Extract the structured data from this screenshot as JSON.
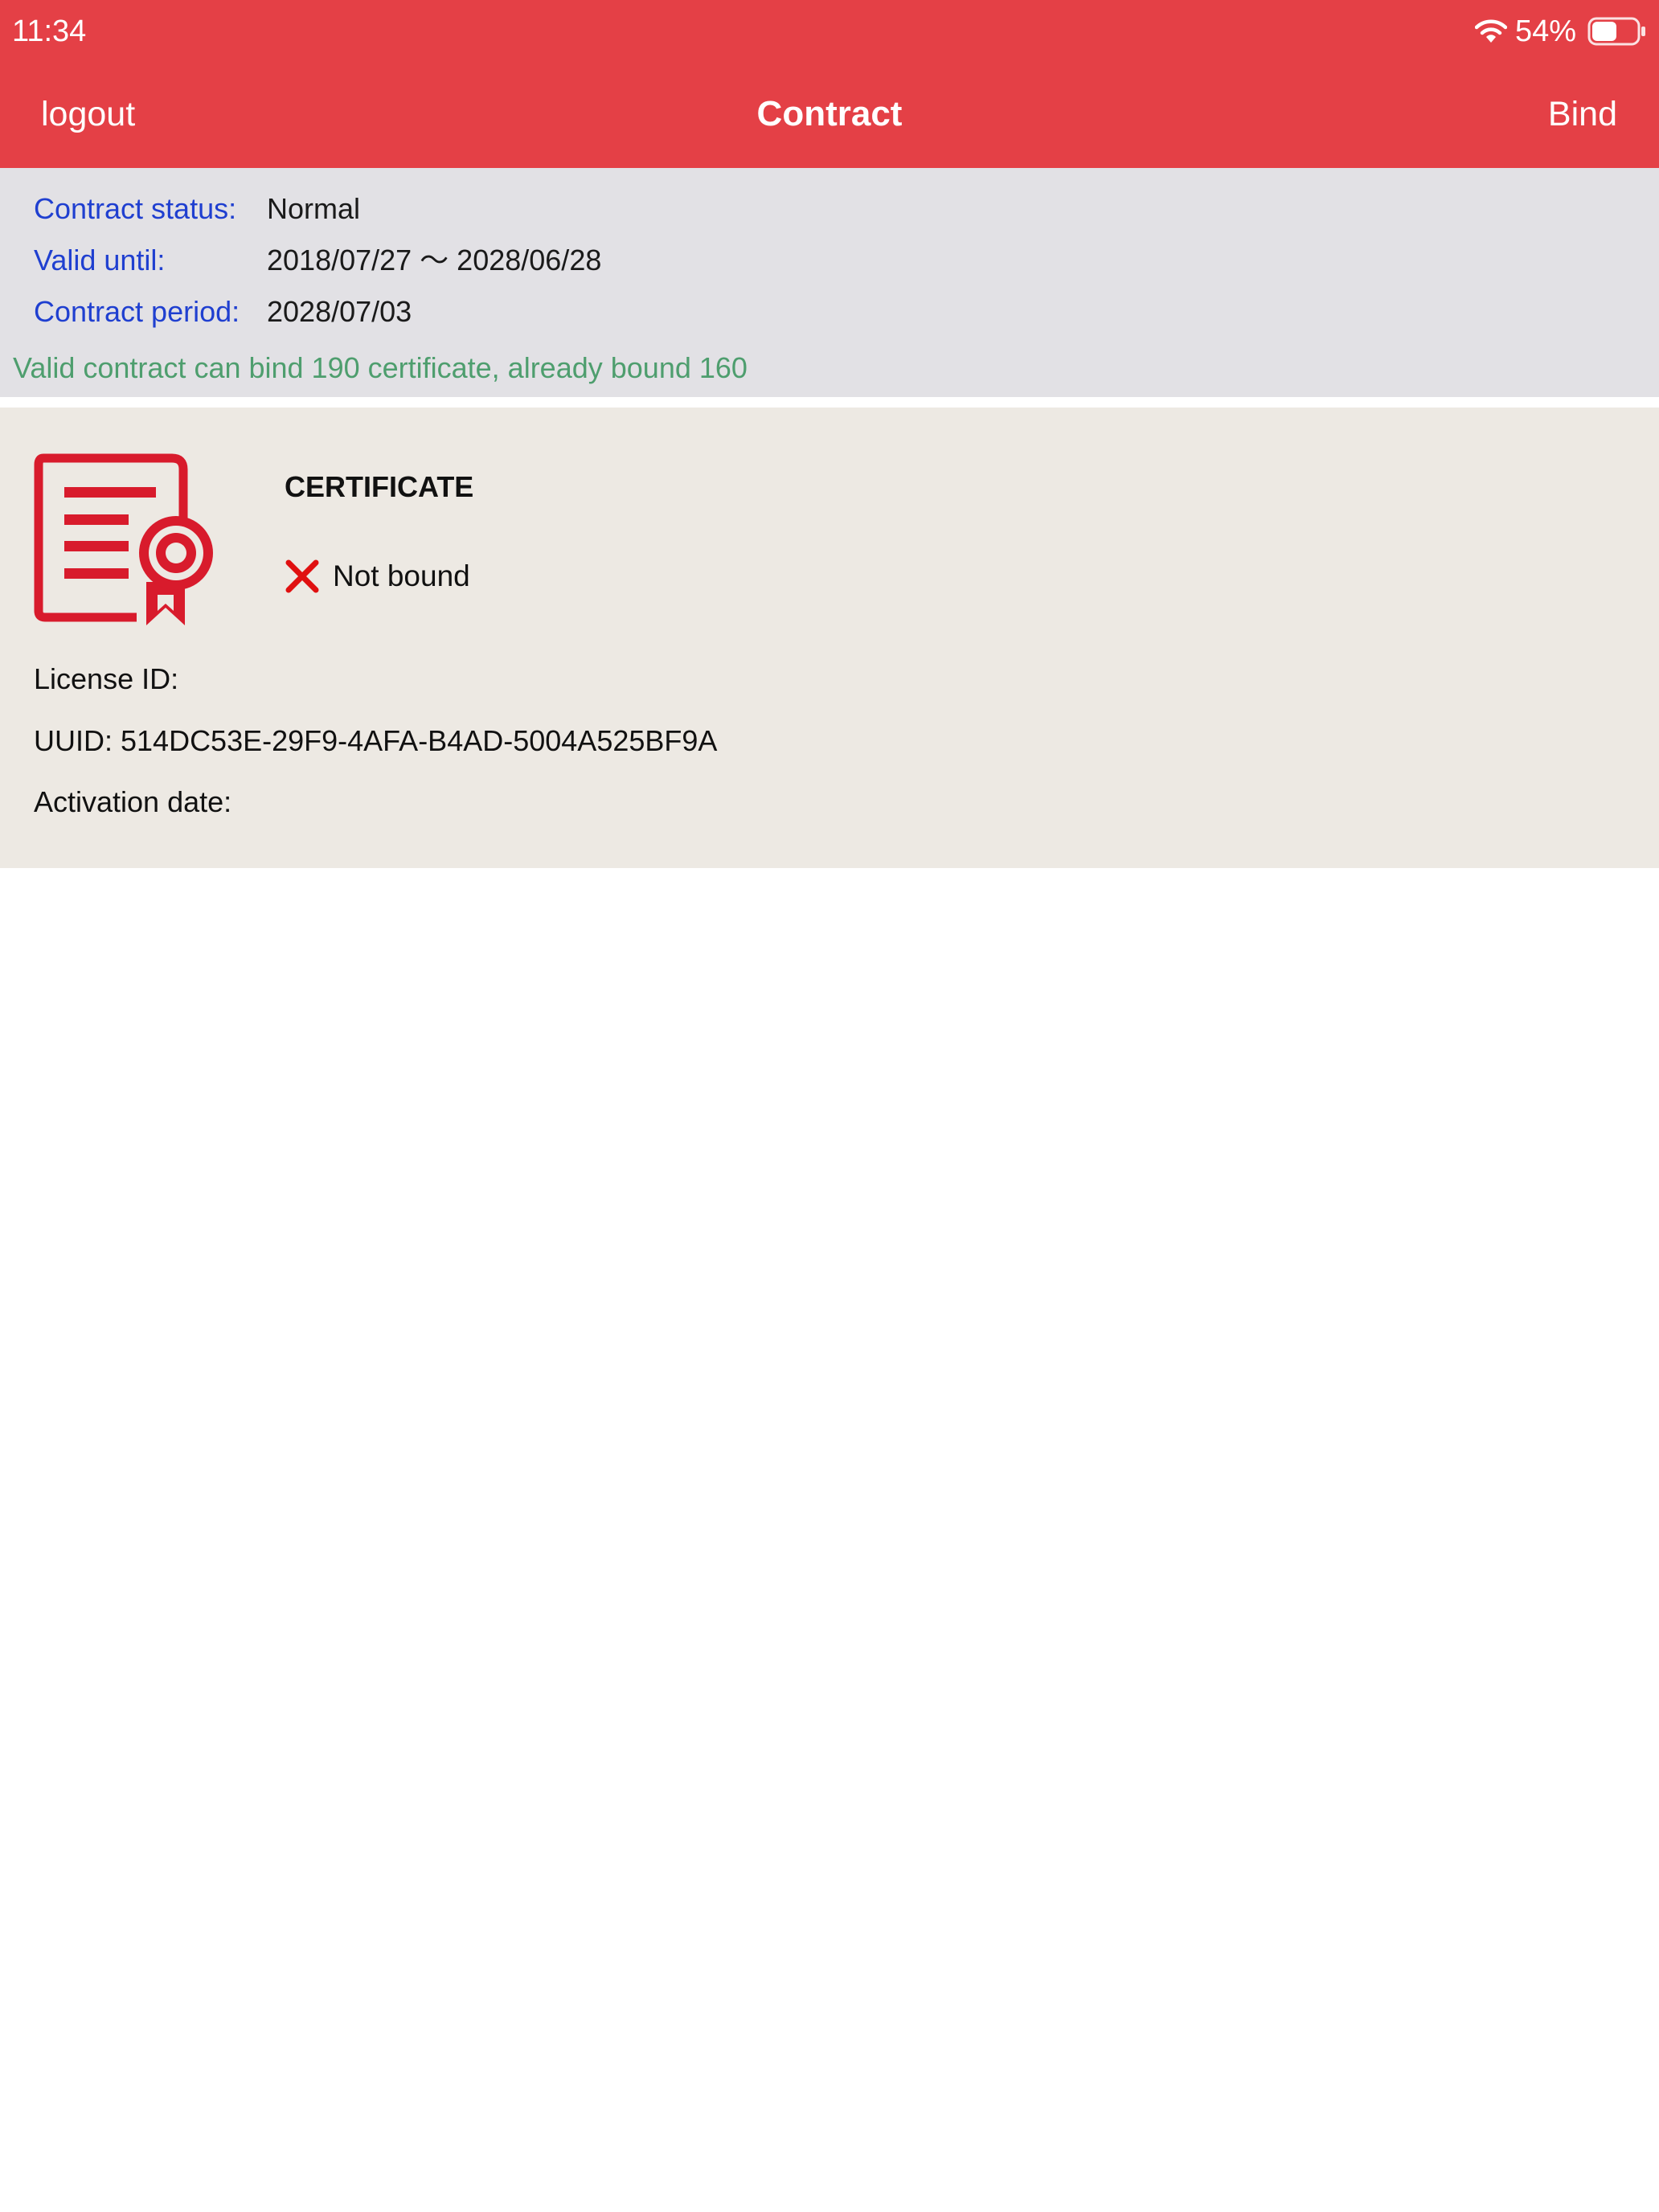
{
  "status_bar": {
    "time": "11:34",
    "battery_percent": "54%",
    "battery_level": 0.54,
    "icons": [
      "wifi-icon",
      "battery-icon"
    ]
  },
  "nav": {
    "left_label": "logout",
    "title": "Contract",
    "right_label": "Bind"
  },
  "contract": {
    "rows": [
      {
        "label": "Contract status:",
        "value": "Normal"
      },
      {
        "label": "Valid until:",
        "value": "2018/07/27 〜 2028/06/28"
      },
      {
        "label": "Contract period:",
        "value": "2028/07/03"
      }
    ],
    "note": "Valid contract can bind 190 certificate, already bound 160"
  },
  "certificate": {
    "icon": "certificate-icon",
    "title": "CERTIFICATE",
    "status_icon": "x-icon",
    "status": "Not bound",
    "license_id": "License ID:",
    "uuid": "UUID: 514DC53E-29F9-4AFA-B4AD-5004A525BF9A",
    "activation_date": "Activation date:"
  },
  "colors": {
    "header": "#e44046",
    "info_panel": "#e2e1e5",
    "label_blue": "#1f3fd0",
    "note_green": "#4e9e6e",
    "card_bg": "#ede9e3",
    "icon_red": "#d81b2c"
  }
}
